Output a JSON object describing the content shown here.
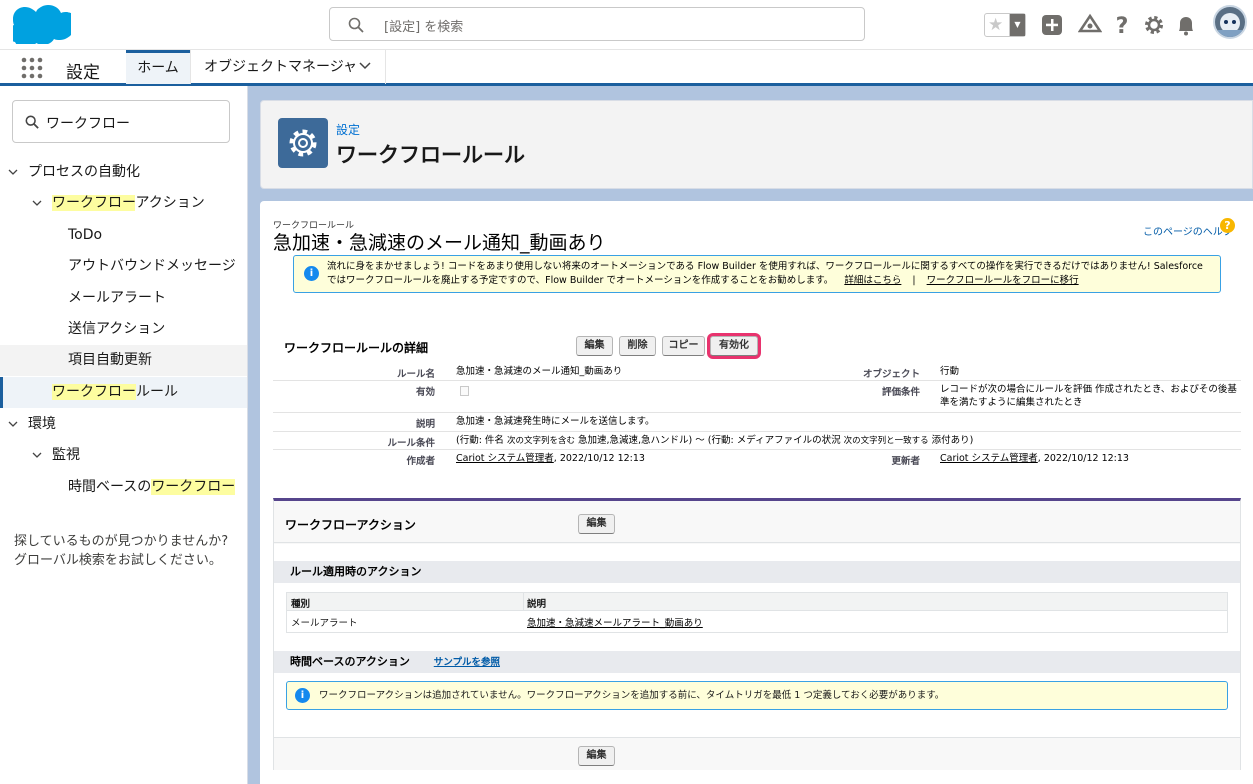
{
  "search": {
    "placeholder": "[設定] を検索"
  },
  "nav": {
    "app_name": "設定",
    "home_tab": "ホーム",
    "object_manager_tab": "オブジェクトマネージャ"
  },
  "sidebar": {
    "search_value": "ワークフロー",
    "items": [
      {
        "label": "プロセスの自動化"
      },
      {
        "label_hl": "ワークフロー",
        "label_rest": "アクション"
      },
      {
        "label": "ToDo"
      },
      {
        "label": "アウトバウンドメッセージ"
      },
      {
        "label": "メールアラート"
      },
      {
        "label": "送信アクション"
      },
      {
        "label": "項目自動更新"
      },
      {
        "label_hl": "ワークフロー",
        "label_rest": "ルール"
      },
      {
        "label": "環境"
      },
      {
        "label": "監視"
      },
      {
        "label_pre": "時間ベースの",
        "label_hl": "ワークフロー"
      }
    ],
    "help_line1": "探しているものが見つかりませんか?",
    "help_line2": "グローバル検索をお試しください。"
  },
  "header": {
    "breadcrumb": "設定",
    "title": "ワークフロールール"
  },
  "rule": {
    "small_label": "ワークフロールール",
    "title": "急加速・急減速のメール通知_動画あり",
    "help_link": "このページのヘルプ",
    "info_text": "流れに身をまかせましょう! コードをあまり使用しない将来のオートメーションである Flow Builder を使用すれば、ワークフロールールに関するすべての操作を実行できるだけではありません! Salesforce ではワークフロールールを廃止する予定ですので、Flow Builder でオートメーションを作成することをお勧めします。",
    "info_link1": "詳細はこちら",
    "info_sep": "|",
    "info_link2": "ワークフロールールをフローに移行"
  },
  "details": {
    "section_title": "ワークフロールールの詳細",
    "buttons": {
      "edit": "編集",
      "delete": "削除",
      "copy": "コピー",
      "activate": "有効化"
    },
    "rule_name_label": "ルール名",
    "rule_name": "急加速・急減速のメール通知_動画あり",
    "object_label": "オブジェクト",
    "object": "行動",
    "active_label": "有効",
    "eval_label": "評価条件",
    "eval_value": "レコードが次の場合にルールを評価 作成されたとき、およびその後基準を満たすように編集されたとき",
    "desc_label": "説明",
    "desc": "急加速・急減速発生時にメールを送信します。",
    "criteria_label": "ルール条件",
    "criteria_a": "(行動: 件名",
    "criteria_b": "次の文字列を含む",
    "criteria_c": "急加速,急減速,急ハンドル) ～ (行動: メディアファイルの状況",
    "criteria_d": "次の文字列と一致する",
    "criteria_e": "添付あり)",
    "created_label": "作成者",
    "created_user": "Cariot システム管理者",
    "created_date": ", 2022/10/12 12:13",
    "modified_label": "更新者",
    "modified_user": "Cariot システム管理者",
    "modified_date": ", 2022/10/12 12:13"
  },
  "actions": {
    "section_title": "ワークフローアクション",
    "edit": "編集",
    "immediate_title": "ルール適用時のアクション",
    "col_type": "種別",
    "col_desc": "説明",
    "row_type": "メールアラート",
    "row_desc": "急加速・急減速メールアラート_動画あり",
    "time_title": "時間ベースのアクション",
    "sample_link": "サンプルを参照",
    "warn_text": "ワークフローアクションは追加されていません。ワークフローアクションを追加する前に、タイムトリガを最低 1 つ定義しておく必要があります。",
    "bottom_edit": "編集"
  },
  "colors": {
    "brand": "#1b5f9e",
    "highlight": "#fdfda0",
    "activate_focus": "#e8336e"
  }
}
